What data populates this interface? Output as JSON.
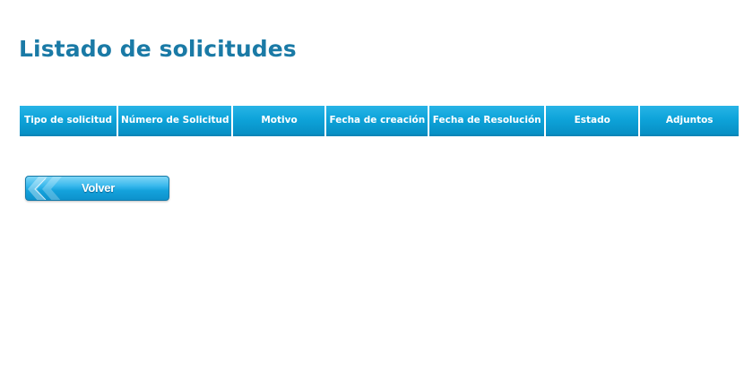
{
  "page": {
    "title": "Listado de solicitudes"
  },
  "table": {
    "columns": [
      "Tipo de solicitud",
      "Número de Solicitud",
      "Motivo",
      "Fecha de creación",
      "Fecha de Resolución",
      "Estado",
      "Adjuntos"
    ],
    "rows": []
  },
  "actions": {
    "back_label": "Volver",
    "back_icon": "double-chevron-left-icon"
  },
  "colors": {
    "title": "#1a7aa6",
    "header_bg": "#0ea4da",
    "header_text": "#ffffff",
    "button_bg": "#14a2dc"
  }
}
